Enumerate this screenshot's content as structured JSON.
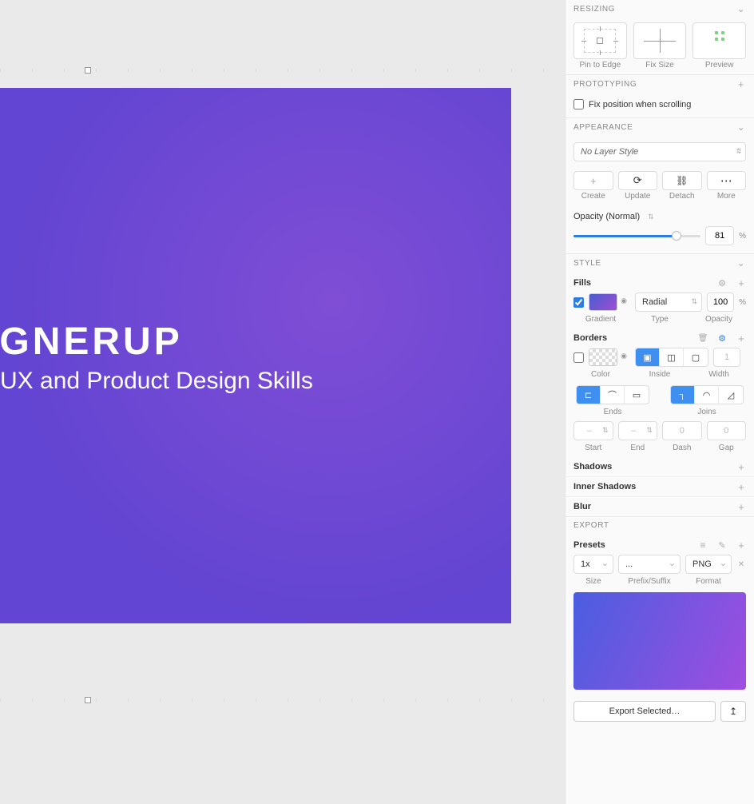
{
  "canvas": {
    "logo_text": "ESIGNERUP",
    "subtitle": "UX and Product Design Skills"
  },
  "resizing": {
    "title": "RESIZING",
    "pin_label": "Pin to Edge",
    "fix_label": "Fix Size",
    "preview_label": "Preview"
  },
  "prototyping": {
    "title": "PROTOTYPING",
    "fix_scroll_label": "Fix position when scrolling",
    "fix_scroll_checked": false
  },
  "appearance": {
    "title": "APPEARANCE",
    "layer_style": "No Layer Style",
    "create": "Create",
    "update": "Update",
    "detach": "Detach",
    "more": "More",
    "opacity_label": "Opacity (Normal)",
    "opacity_value": "81",
    "opacity_unit": "%"
  },
  "style": {
    "title": "STYLE",
    "fills": {
      "title": "Fills",
      "enabled": true,
      "type": "Radial",
      "opacity_value": "100",
      "opacity_unit": "%",
      "gradient_label": "Gradient",
      "type_label": "Type",
      "opacity_label": "Opacity"
    },
    "borders": {
      "title": "Borders",
      "enabled": false,
      "width_value": "1",
      "color_label": "Color",
      "inside_label": "Inside",
      "width_label": "Width",
      "ends_label": "Ends",
      "joins_label": "Joins",
      "start_label": "Start",
      "end_label": "End",
      "dash_label": "Dash",
      "gap_label": "Gap",
      "start_value": "–",
      "end_value": "–",
      "dash_value": "0",
      "gap_value": "0"
    },
    "shadows": {
      "title": "Shadows"
    },
    "inner_shadows": {
      "title": "Inner Shadows"
    },
    "blur": {
      "title": "Blur"
    }
  },
  "export": {
    "title": "EXPORT",
    "presets": "Presets",
    "size_value": "1x",
    "prefix_value": "...",
    "format_value": "PNG",
    "size_label": "Size",
    "prefix_label": "Prefix/Suffix",
    "format_label": "Format",
    "button": "Export Selected…"
  }
}
